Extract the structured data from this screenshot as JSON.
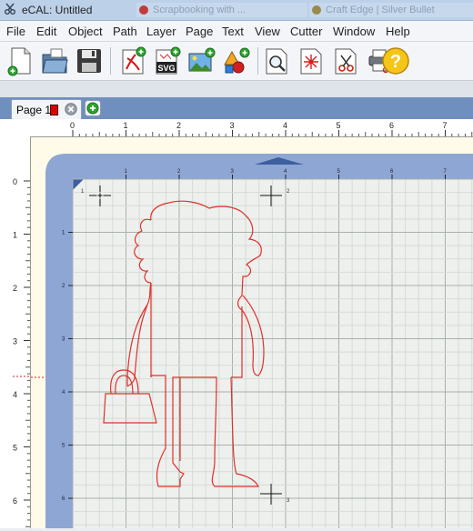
{
  "window": {
    "title": "eCAL: Untitled",
    "background_tabs": [
      "Scrapbooking with ...",
      "Craft Edge | Silver Bullet"
    ]
  },
  "menu": [
    "File",
    "Edit",
    "Object",
    "Path",
    "Layer",
    "Page",
    "Text",
    "View",
    "Cutter",
    "Window",
    "Help"
  ],
  "toolbar": [
    {
      "name": "new-document",
      "icon": "new-page-icon"
    },
    {
      "name": "open",
      "icon": "open-folder-icon"
    },
    {
      "name": "save",
      "icon": "floppy-disk-icon"
    },
    {
      "name": "import-pdf",
      "icon": "pdf-import-icon"
    },
    {
      "name": "import-svg",
      "icon": "svg-import-icon",
      "label": "SVG"
    },
    {
      "name": "import-image",
      "icon": "image-import-icon"
    },
    {
      "name": "add-shapes",
      "icon": "shapes-icon"
    },
    {
      "name": "preview",
      "icon": "magnifier-page-icon"
    },
    {
      "name": "registration",
      "icon": "laser-page-icon"
    },
    {
      "name": "cut",
      "icon": "scissors-page-icon"
    },
    {
      "name": "print-and-cut",
      "icon": "printer-scissors-icon"
    },
    {
      "name": "help",
      "icon": "question-mark-icon",
      "label": "?"
    }
  ],
  "tabs": [
    {
      "label": "Page 1",
      "swatch": "#dd0000"
    }
  ],
  "ruler": {
    "horizontal": [
      "0",
      "1",
      "2",
      "3",
      "4",
      "5",
      "6",
      "7"
    ],
    "vertical": [
      "0",
      "1",
      "2",
      "3",
      "4",
      "5",
      "6"
    ],
    "mat_horizontal": [
      "0",
      "1",
      "2",
      "3",
      "4",
      "5",
      "6",
      "7"
    ],
    "mat_vertical": [
      "1",
      "2",
      "3",
      "4",
      "5",
      "6"
    ]
  },
  "registration_marks": [
    "1",
    "2",
    "3"
  ],
  "colors": {
    "cut_line": "#e0302a",
    "mat": "#8ea6d4",
    "mat_inner": "#eef0ee",
    "grid": "#cfd6d0"
  }
}
